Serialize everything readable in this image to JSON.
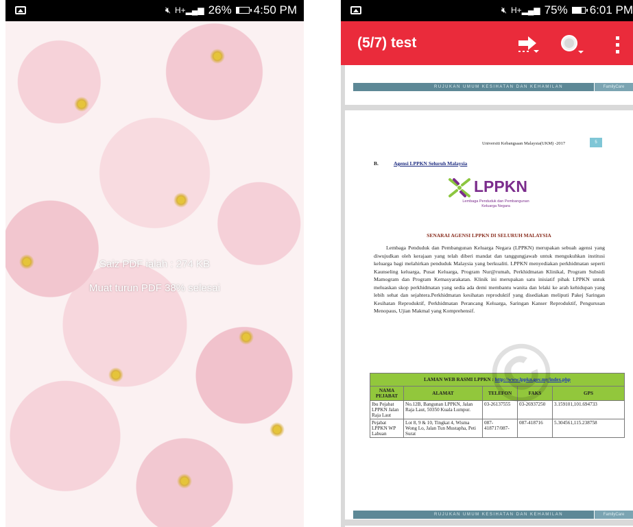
{
  "left_phone": {
    "status": {
      "time": "4:50 PM",
      "battery": "26%",
      "battery_level": 0.26
    },
    "download": {
      "size_text": "Saiz PDF ialah : 274 KB",
      "progress_text": "Muat turun PDF 38% selesai"
    }
  },
  "right_phone": {
    "status": {
      "time": "6:01 PM",
      "battery": "75%",
      "battery_level": 0.75
    },
    "toolbar": {
      "title": "(5/7) test",
      "icons": [
        "share-icon",
        "search-icon",
        "overflow-menu-icon"
      ]
    },
    "header_banner": {
      "text": "RUJUKAN UMUM KESIHATAN DAN KEHAMILAN",
      "tag": "FamilyCare"
    },
    "page": {
      "header": "Universiti Kebangsaan Malaysia(UKM) -2017",
      "page_number": "5",
      "section_letter": "B.",
      "section_title": "Agensi LPPKN Seluruh Malaysia",
      "logo_text": "LPPKN",
      "logo_sub1": "Lembaga Penduduk dan Pembangunan",
      "logo_sub2": "Keluarga Negara",
      "heading": "SENARAI AGENSI LPPKN DI SELURUH MALAYSIA",
      "paragraph": "Lembaga Penduduk dan Pembangunan Keluarga Negara (LPPKN) merupakan sebuah agensi yang diwujudkan oleh kerajaan yang telah diberi mandat dan tanggungjawab untuk mengukuhkan institusi keluarga bagi melahirkan penduduk Malaysia yang berkualiti. LPPKN menyediakan perkhidmatan seperti Kaunseling keluarga, Pusat Keluarga, Program Nur@rumah, Perkhidmatan Klinikal, Program Subsidi Mamogram dan Program Kemasyarakatan. Klinik ini merupakan satu inisiatif pihak LPPKN untuk meluaskan skop perkhidmatan yang sedia ada demi membantu wanita dan lelaki ke arah kehidupan yang lebih sehat dan sejahtera.Perkhidmatan kesihatan reproduktif yang disediakan meliputi Pakej Saringan Kesihatan Reproduktif, Perkhidmatan Perancang Keluarga, Saringan Kanser Reproduktif, Pengurusan Menopaus, Ujian Makmal yang Komprehensif.",
      "table": {
        "title_prefix": "LAMAN WEB RASMI LPPKN : ",
        "title_link": "http://www.lppkn.gov.my/index.php",
        "columns": [
          "NAMA PEJABAT",
          "ALAMAT",
          "TELEFON",
          "FAKS",
          "GPS"
        ],
        "rows": [
          [
            "Ibu Pejabat LPPKN Jalan Raja Laut",
            "No.12B, Bangunan LPPKN, Jalan Raja Laut, 50350 Kuala Lumpur.",
            "03-26137555",
            "03-26937250",
            "3.159101,101.694733"
          ],
          [
            "Pejabat LPPKN WP Labuan",
            "Lot 8, 9 & 10, Tingkat 4, Wisma Wong Lo, Jalan Tun Mustapha, Peti Surat",
            "087-418717/087-",
            "087-418716",
            "5.304561,115.238758"
          ]
        ]
      }
    },
    "footer_banner": {
      "text": "RUJUKAN UMUM KESIHATAN DAN KEHAMILAN",
      "tag": "FamilyCare"
    }
  },
  "colors": {
    "toolbar_red": "#ea2b3b",
    "banner_teal": "#5d8896",
    "table_green": "#92c73c"
  }
}
